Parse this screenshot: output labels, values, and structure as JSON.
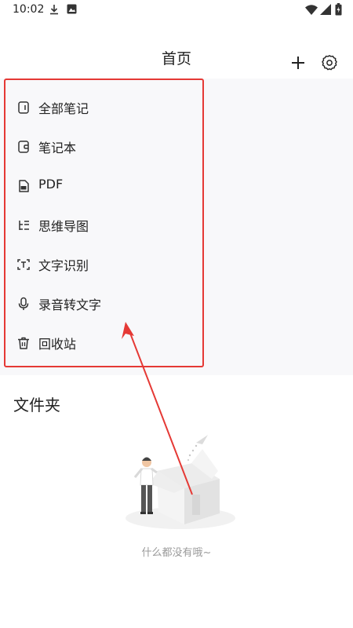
{
  "status_bar": {
    "time": "10:02"
  },
  "header": {
    "title": "首页"
  },
  "menu": {
    "items": [
      {
        "label": "全部笔记",
        "icon": "notes-icon"
      },
      {
        "label": "笔记本",
        "icon": "notebook-icon"
      },
      {
        "label": "PDF",
        "icon": "pdf-icon"
      },
      {
        "label": "思维导图",
        "icon": "mindmap-icon"
      },
      {
        "label": "文字识别",
        "icon": "text-scan-icon"
      },
      {
        "label": "录音转文字",
        "icon": "microphone-icon"
      },
      {
        "label": "回收站",
        "icon": "trash-icon"
      }
    ]
  },
  "folders": {
    "title": "文件夹",
    "empty_text": "什么都没有哦~"
  },
  "colors": {
    "highlight": "#e53935",
    "menu_bg": "#f8f8fa",
    "text": "#222222",
    "muted": "#9a9a9a"
  }
}
